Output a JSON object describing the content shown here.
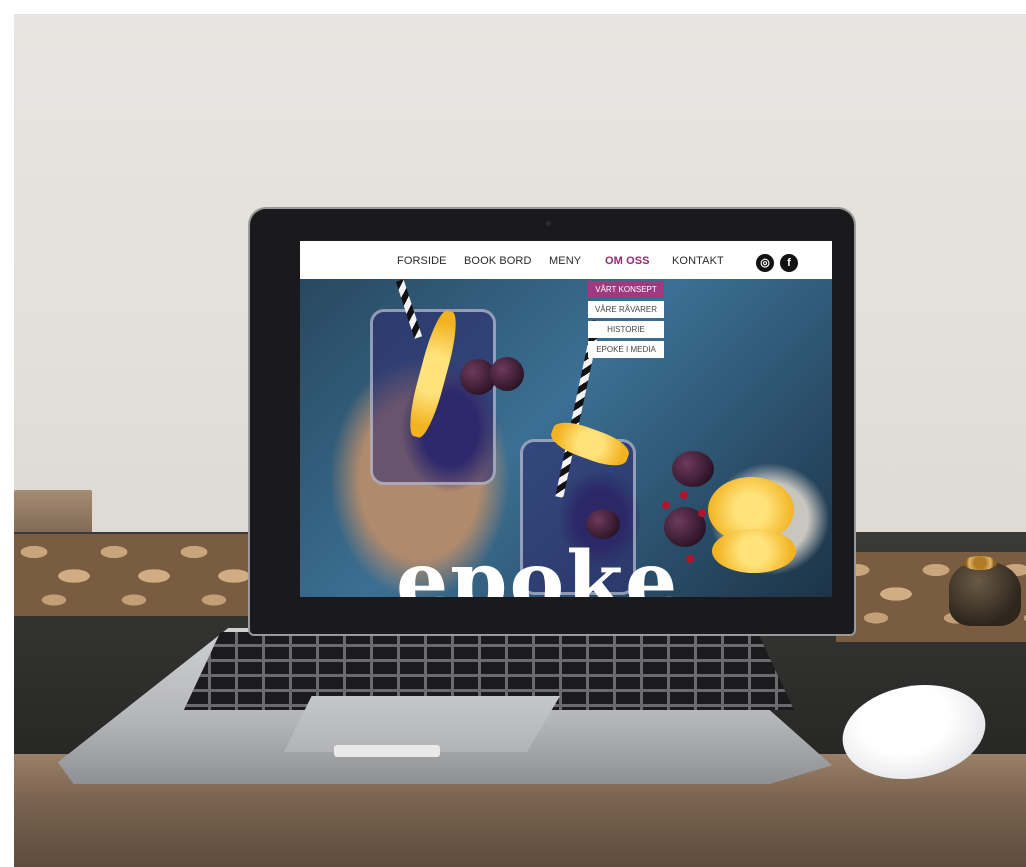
{
  "nav": {
    "items": [
      {
        "label": "FORSIDE",
        "active": false
      },
      {
        "label": "BOOK BORD",
        "active": false
      },
      {
        "label": "MENY",
        "active": false
      },
      {
        "label": "OM OSS",
        "active": true
      },
      {
        "label": "KONTAKT",
        "active": false
      }
    ],
    "social": [
      {
        "icon": "instagram-icon",
        "glyph": "◎"
      },
      {
        "icon": "facebook-icon",
        "glyph": "f"
      }
    ]
  },
  "dropdown": {
    "items": [
      {
        "label": "VÅRT KONSEPT",
        "active": true
      },
      {
        "label": "VÅRE RÅVARER",
        "active": false
      },
      {
        "label": "HISTORIE",
        "active": false
      },
      {
        "label": "EPOKE I MEDIA",
        "active": false
      }
    ]
  },
  "hero": {
    "wordmark": "epoke"
  },
  "colors": {
    "accent": "#8e2d6b",
    "dropdown_active": "#a03a80"
  }
}
